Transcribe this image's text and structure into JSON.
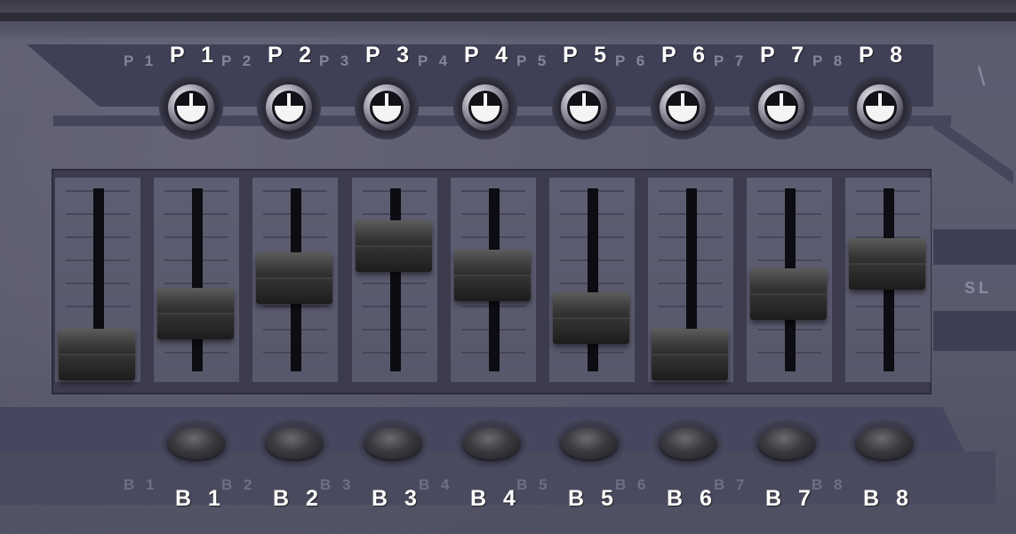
{
  "knobs": [
    {
      "label": "P 1",
      "ghost": "P 1"
    },
    {
      "label": "P 2",
      "ghost": "P 2"
    },
    {
      "label": "P 3",
      "ghost": "P 3"
    },
    {
      "label": "P 4",
      "ghost": "P 4"
    },
    {
      "label": "P 5",
      "ghost": "P 5"
    },
    {
      "label": "P 6",
      "ghost": "P 6"
    },
    {
      "label": "P 7",
      "ghost": "P 7"
    },
    {
      "label": "P 8",
      "ghost": "P 8"
    }
  ],
  "faders": [
    {
      "level": 0.0
    },
    {
      "level": 0.28
    },
    {
      "level": 0.52
    },
    {
      "level": 0.74
    },
    {
      "level": 0.54
    },
    {
      "level": 0.25
    },
    {
      "level": 0.0
    },
    {
      "level": 0.41
    },
    {
      "level": 0.62
    }
  ],
  "buttons": [
    {
      "label": "B 1",
      "ghost": "B 1"
    },
    {
      "label": "B 2",
      "ghost": "B 2"
    },
    {
      "label": "B 3",
      "ghost": "B 3"
    },
    {
      "label": "B 4",
      "ghost": "B 4"
    },
    {
      "label": "B 5",
      "ghost": "B 5"
    },
    {
      "label": "B 6",
      "ghost": "B 6"
    },
    {
      "label": "B 7",
      "ghost": "B 7"
    },
    {
      "label": "B 8",
      "ghost": "B 8"
    }
  ],
  "side": {
    "partial_text": "SL",
    "partial_glyph": "\\"
  },
  "colors": {
    "label": "#ffffff",
    "panel": "#5a5a6c",
    "fader_cap": "#333333"
  }
}
